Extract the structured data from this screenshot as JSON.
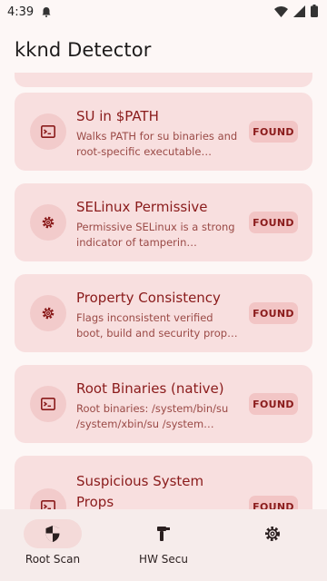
{
  "status_bar": {
    "time": "4:39",
    "icons": [
      "notification-icon",
      "wifi-icon",
      "cellular-icon",
      "battery-icon"
    ]
  },
  "app": {
    "title": "kknd Detector"
  },
  "checks": [
    {
      "title": "SU in $PATH",
      "description": "Walks PATH for su binaries and root-specific executable…",
      "status": "FOUND",
      "icon": "terminal-icon"
    },
    {
      "title": "SELinux Permissive",
      "description": "Permissive SELinux is a strong indicator of tamperin…",
      "status": "FOUND",
      "icon": "gear-icon"
    },
    {
      "title": "Property Consistency",
      "description": "Flags inconsistent verified boot, build and security prop…",
      "status": "FOUND",
      "icon": "gear-icon"
    },
    {
      "title": "Root Binaries (native)",
      "description": "Root binaries: /system/bin/su /system/xbin/su /system…",
      "status": "FOUND",
      "icon": "terminal-icon"
    },
    {
      "title": "Suspicious System Props",
      "description": "",
      "status": "FOUND",
      "icon": "terminal-icon"
    }
  ],
  "bottom_nav": {
    "items": [
      {
        "label": "Root Scan",
        "icon": "shield-icon",
        "active": true
      },
      {
        "label": "HW Secu",
        "icon": "hardware-icon",
        "active": false
      },
      {
        "label": "",
        "icon": "gear-icon",
        "active": false
      }
    ]
  },
  "colors": {
    "background": "#FDF7F6",
    "card": "#F8DFDF",
    "accent": "#8A1B1B",
    "badge": "#F2C5C5",
    "nav_background": "#F6ECEB"
  }
}
